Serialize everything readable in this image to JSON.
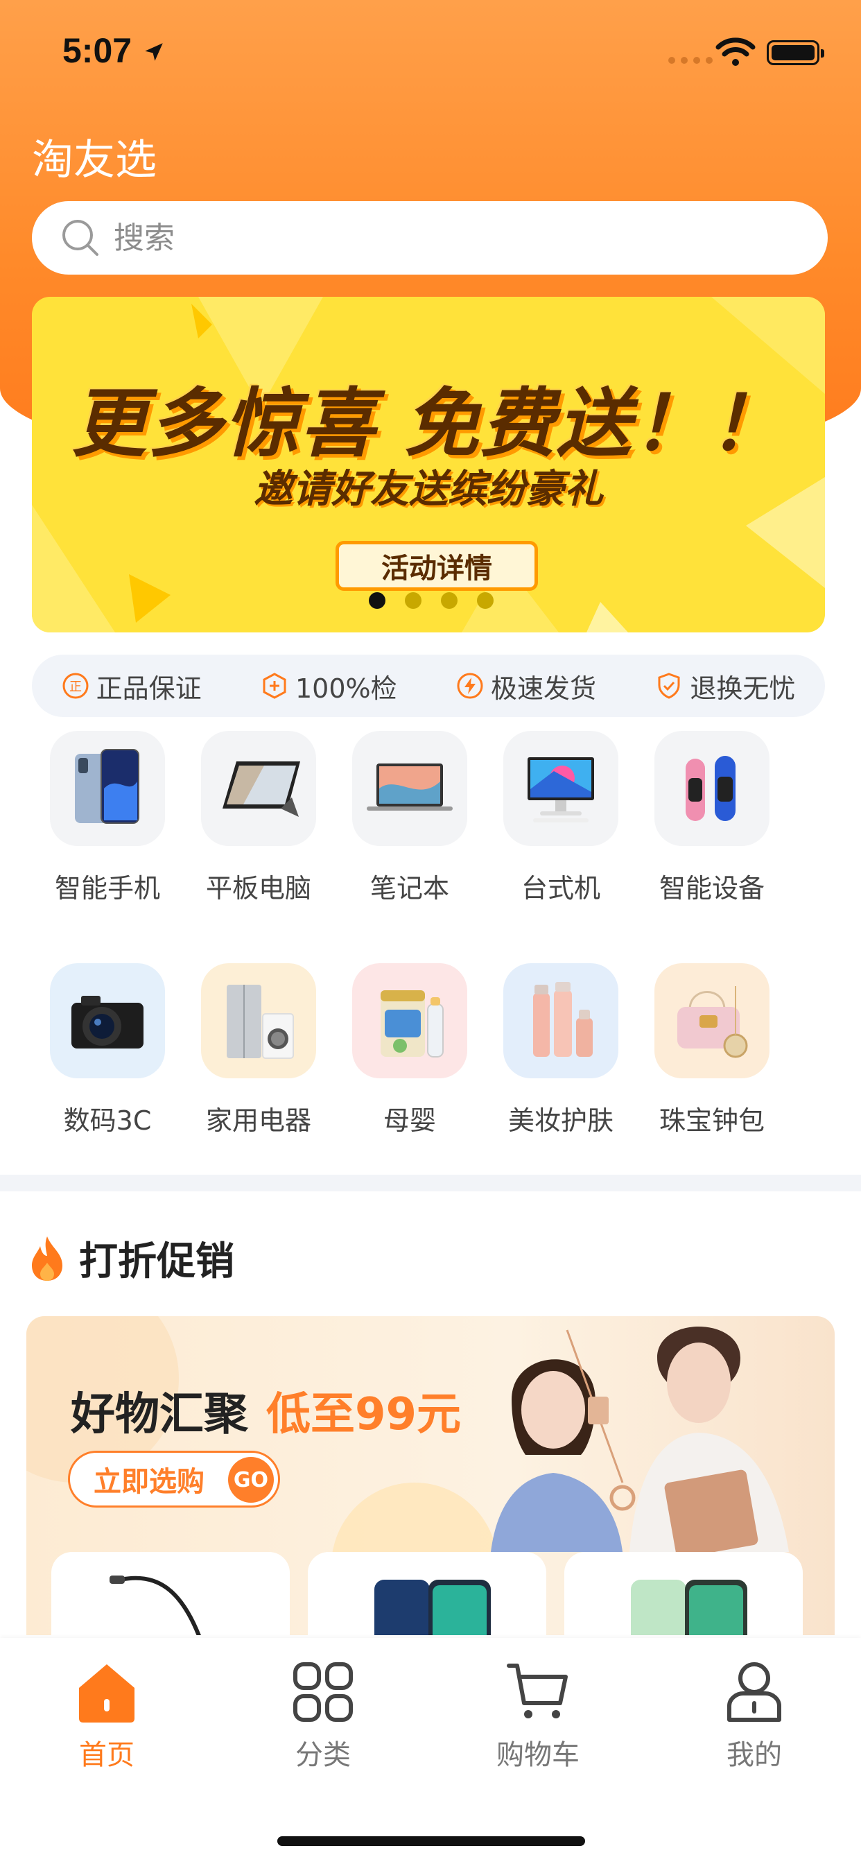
{
  "status_bar": {
    "time": "5:07"
  },
  "app": {
    "title": "淘友选"
  },
  "search": {
    "placeholder": "搜索"
  },
  "banner": {
    "headline": "更多惊喜 免费送！！",
    "subline": "邀请好友送缤纷豪礼",
    "cta": "活动详情",
    "pages": 4,
    "active_page": 1
  },
  "guarantees": [
    {
      "icon": "authentic-icon",
      "label": "正品保证"
    },
    {
      "icon": "inspect-icon",
      "label": "100%检"
    },
    {
      "icon": "fast-shipping-icon",
      "label": "极速发货"
    },
    {
      "icon": "return-shield-icon",
      "label": "退换无忧"
    }
  ],
  "categories": [
    {
      "label": "智能手机",
      "icon": "smartphone-icon",
      "bg": "#f3f4f6"
    },
    {
      "label": "平板电脑",
      "icon": "tablet-icon",
      "bg": "#f3f4f6"
    },
    {
      "label": "笔记本",
      "icon": "laptop-icon",
      "bg": "#f3f4f6"
    },
    {
      "label": "台式机",
      "icon": "desktop-icon",
      "bg": "#f3f4f6"
    },
    {
      "label": "智能设备",
      "icon": "smart-band-icon",
      "bg": "#f3f4f6"
    },
    {
      "label": "数码3C",
      "icon": "camera-icon",
      "bg": "#e4f0fb"
    },
    {
      "label": "家用电器",
      "icon": "appliance-icon",
      "bg": "#fdefd6"
    },
    {
      "label": "母婴",
      "icon": "baby-formula-icon",
      "bg": "#fde6e6"
    },
    {
      "label": "美妆护肤",
      "icon": "cosmetics-icon",
      "bg": "#e3eefb"
    },
    {
      "label": "珠宝钟包",
      "icon": "handbag-icon",
      "bg": "#fdecd7"
    }
  ],
  "promo_section": {
    "title": "打折促销",
    "headline_main": "好物汇聚",
    "headline_accent": "低至99元",
    "button_label": "立即选购",
    "go_label": "GO"
  },
  "tabbar": [
    {
      "label": "首页",
      "icon": "home-icon",
      "active": true
    },
    {
      "label": "分类",
      "icon": "category-grid-icon",
      "active": false
    },
    {
      "label": "购物车",
      "icon": "cart-icon",
      "active": false
    },
    {
      "label": "我的",
      "icon": "profile-icon",
      "active": false
    }
  ],
  "colors": {
    "brand_orange": "#ff7a1c",
    "banner_yellow": "#ffe23a",
    "accent_text": "#ff7f2a"
  }
}
